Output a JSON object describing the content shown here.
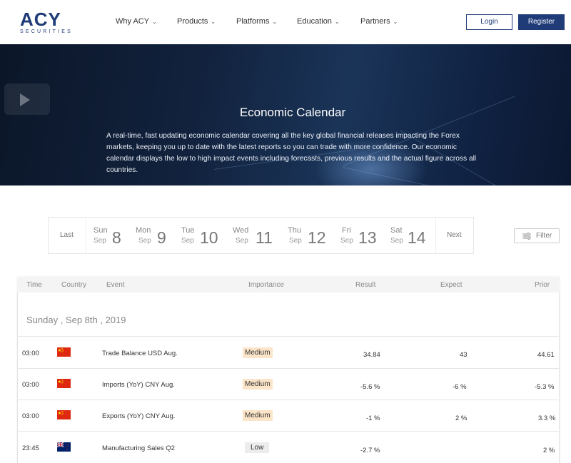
{
  "nav": {
    "logo_main": "ACY",
    "logo_sub": "SECURITIES",
    "items": [
      "Why ACY",
      "Products",
      "Platforms",
      "Education",
      "Partners"
    ],
    "login": "Login",
    "register": "Register"
  },
  "hero": {
    "title": "Economic Calendar",
    "description": "A real-time, fast updating economic calendar covering all the key global financial releases impacting the Forex markets, keeping you up to date with the latest reports so you can trade with more confidence. Our economic calendar displays the low to high impact events including forecasts, previous results and the actual figure across all countries."
  },
  "datebar": {
    "last": "Last",
    "next": "Next",
    "days": [
      {
        "name": "Sun",
        "month": "Sep",
        "num": "8"
      },
      {
        "name": "Mon",
        "month": "Sep",
        "num": "9"
      },
      {
        "name": "Tue",
        "month": "Sep",
        "num": "10"
      },
      {
        "name": "Wed",
        "month": "Sep",
        "num": "11"
      },
      {
        "name": "Thu",
        "month": "Sep",
        "num": "12"
      },
      {
        "name": "Fri",
        "month": "Sep",
        "num": "13"
      },
      {
        "name": "Sat",
        "month": "Sep",
        "num": "14"
      }
    ]
  },
  "filter": {
    "label": "Filter"
  },
  "table": {
    "headers": {
      "time": "Time",
      "country": "Country",
      "event": "Event",
      "importance": "Importance",
      "result": "Result",
      "expect": "Expect",
      "prior": "Prior"
    },
    "date_heading": "Sunday , Sep 8th , 2019",
    "rows": [
      {
        "time": "03:00",
        "flag": "china-flag-icon",
        "event": "Trade Balance USD Aug.",
        "importance": "Medium",
        "result": "34.84",
        "expect": "43",
        "prior": "44.61"
      },
      {
        "time": "03:00",
        "flag": "china-flag-icon",
        "event": "Imports (YoY) CNY Aug.",
        "importance": "Medium",
        "result": "-5.6 %",
        "expect": "-6 %",
        "prior": "-5.3 %"
      },
      {
        "time": "03:00",
        "flag": "china-flag-icon",
        "event": "Exports (YoY) CNY Aug.",
        "importance": "Medium",
        "result": "-1 %",
        "expect": "2 %",
        "prior": "3.3 %"
      },
      {
        "time": "23:45",
        "flag": "new-zealand-flag-icon",
        "event": "Manufacturing Sales Q2",
        "importance": "Low",
        "result": "-2.7 %",
        "expect": "",
        "prior": "2 %"
      }
    ]
  },
  "colors": {
    "brand": "#1f3c78",
    "medium": "#fbe4c8",
    "low": "#ececec"
  }
}
